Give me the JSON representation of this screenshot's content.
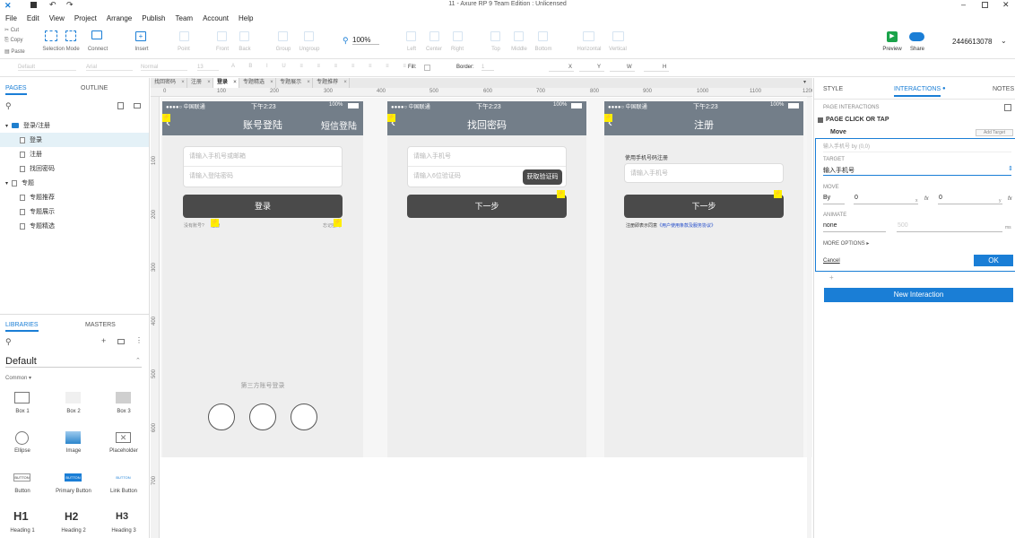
{
  "window": {
    "title": "11 - Axure RP 9 Team Edition : Unlicensed"
  },
  "menu": [
    "File",
    "Edit",
    "View",
    "Project",
    "Arrange",
    "Publish",
    "Team",
    "Account",
    "Help"
  ],
  "clipboard": {
    "cut": "Cut",
    "copy": "Copy",
    "paste": "Paste"
  },
  "toolbar": {
    "selection_mode": "Selection Mode",
    "connect": "Connect",
    "insert": "Insert",
    "point": "Point",
    "front": "Front",
    "back": "Back",
    "group": "Group",
    "ungroup": "Ungroup",
    "zoom": "100%",
    "left": "Left",
    "center": "Center",
    "right": "Right",
    "top": "Top",
    "middle": "Middle",
    "bottom": "Bottom",
    "horizontal": "Horizontal",
    "vertical": "Vertical",
    "preview": "Preview",
    "share": "Share",
    "account": "2446613078"
  },
  "format": {
    "style": "Default",
    "font": "Arial",
    "weight": "Normal",
    "size": "13",
    "fill": "Fill:",
    "border": "Border:",
    "border_value": "1",
    "x": "X",
    "y": "Y",
    "w": "W",
    "h": "H"
  },
  "left": {
    "tab_pages": "PAGES",
    "tab_outline": "OUTLINE",
    "tree": [
      {
        "label": "登录/注册",
        "type": "folder",
        "level": 0
      },
      {
        "label": "登录",
        "type": "page",
        "level": 1,
        "selected": true
      },
      {
        "label": "注册",
        "type": "page",
        "level": 1
      },
      {
        "label": "找回密码",
        "type": "page",
        "level": 1
      },
      {
        "label": "专题",
        "type": "page",
        "level": 0
      },
      {
        "label": "专题推荐",
        "type": "page",
        "level": 1
      },
      {
        "label": "专题展示",
        "type": "page",
        "level": 1
      },
      {
        "label": "专题精选",
        "type": "page",
        "level": 1
      }
    ],
    "tab_libraries": "LIBRARIES",
    "tab_masters": "MASTERS",
    "library": "Default",
    "group": "Common ▾",
    "widgets": [
      "Box 1",
      "Box 2",
      "Box 3",
      "Ellipse",
      "Image",
      "Placeholder",
      "Button",
      "Primary Button",
      "Link Button",
      "Heading 1",
      "Heading 2",
      "Heading 3"
    ],
    "widget_texts": {
      "h1": "H1",
      "h2": "H2",
      "h3": "H3",
      "btn": "BUTTON"
    }
  },
  "page_tabs": [
    "找回密码",
    "注册",
    "登录",
    "专题精选",
    "专题展示",
    "专题推荐"
  ],
  "active_tab": "登录",
  "ruler_h": [
    "0",
    "100",
    "200",
    "300",
    "400",
    "500",
    "600",
    "700",
    "800",
    "900",
    "1000",
    "1100",
    "1200"
  ],
  "ruler_v": [
    "100",
    "200",
    "300",
    "400",
    "500",
    "600",
    "700"
  ],
  "status": {
    "carrier": "●●●●○ 中国联通",
    "time": "下午2:23",
    "battery": "100%"
  },
  "phone1": {
    "title": "账号登陆",
    "right": "短信登陆",
    "user_ph": "请输入手机号或邮箱",
    "pwd_ph": "请输入登陆密码",
    "login": "登录",
    "no_account": "没有账号?",
    "register": "注册",
    "forgot": "忘记密码",
    "third_party": "第三方账号登录"
  },
  "phone2": {
    "title": "找回密码",
    "phone_ph": "请输入手机号",
    "code_ph": "请输入6位验证码",
    "get_code": "获取验证码",
    "next": "下一步"
  },
  "phone3": {
    "title": "注册",
    "hint": "使用手机号码注册",
    "phone_ph": "请输入手机号",
    "next": "下一步",
    "agree": "注册即表示同意",
    "agree_link": "《用户使用条款及服务协议》"
  },
  "right": {
    "tab_style": "STYLE",
    "tab_interactions": "INTERACTIONS",
    "tab_notes": "NOTES",
    "section": "PAGE INTERACTIONS",
    "event": "PAGE CLICK OR TAP",
    "action": "Move",
    "add_target": "Add Target",
    "move_desc": "输入手机号 by (0,0)",
    "target_label": "TARGET",
    "target_value": "输入手机号",
    "move_label": "MOVE",
    "move_mode": "By",
    "x": "0",
    "y": "0",
    "x_axis": "x",
    "y_axis": "y",
    "fx": "fx",
    "animate_label": "ANIMATE",
    "animate_value": "none",
    "duration": "500",
    "ms": "ms",
    "more": "MORE OPTIONS ▸",
    "cancel": "Cancel",
    "ok": "OK",
    "plus": "+",
    "new_interaction": "New Interaction"
  },
  "colors": {
    "accent": "#1a7ed6",
    "nav": "#737e89",
    "button": "#4a4a4a",
    "note": "#ffee00"
  }
}
